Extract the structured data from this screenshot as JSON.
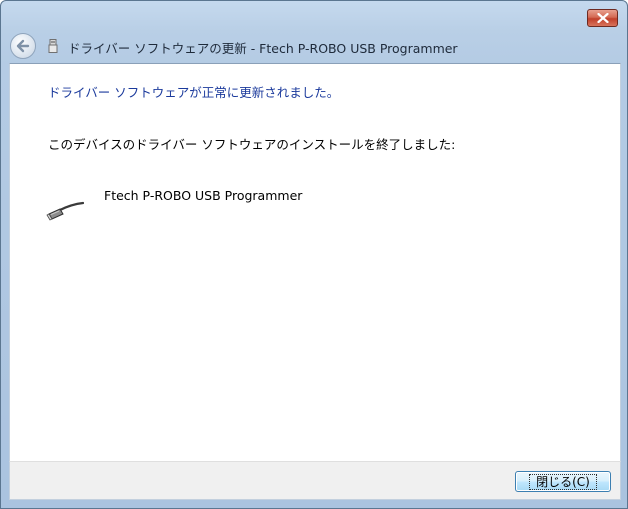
{
  "window": {
    "title": "ドライバー ソフトウェアの更新 - Ftech P-ROBO USB Programmer"
  },
  "titlebar": {
    "close_icon": "close-icon",
    "back_icon": "back-arrow-icon",
    "device_icon": "usb-device-icon"
  },
  "content": {
    "status_heading": "ドライバー ソフトウェアが正常に更新されました。",
    "body_text": "このデバイスのドライバー ソフトウェアのインストールを終了しました:",
    "device": {
      "icon": "usb-cable-icon",
      "name": "Ftech P-ROBO USB Programmer"
    }
  },
  "footer": {
    "close_button_label": "閉じる(C)"
  },
  "colors": {
    "heading_text": "#1b3a9c",
    "window_frame": "#b9cfe6",
    "close_button_red": "#c1402b"
  }
}
